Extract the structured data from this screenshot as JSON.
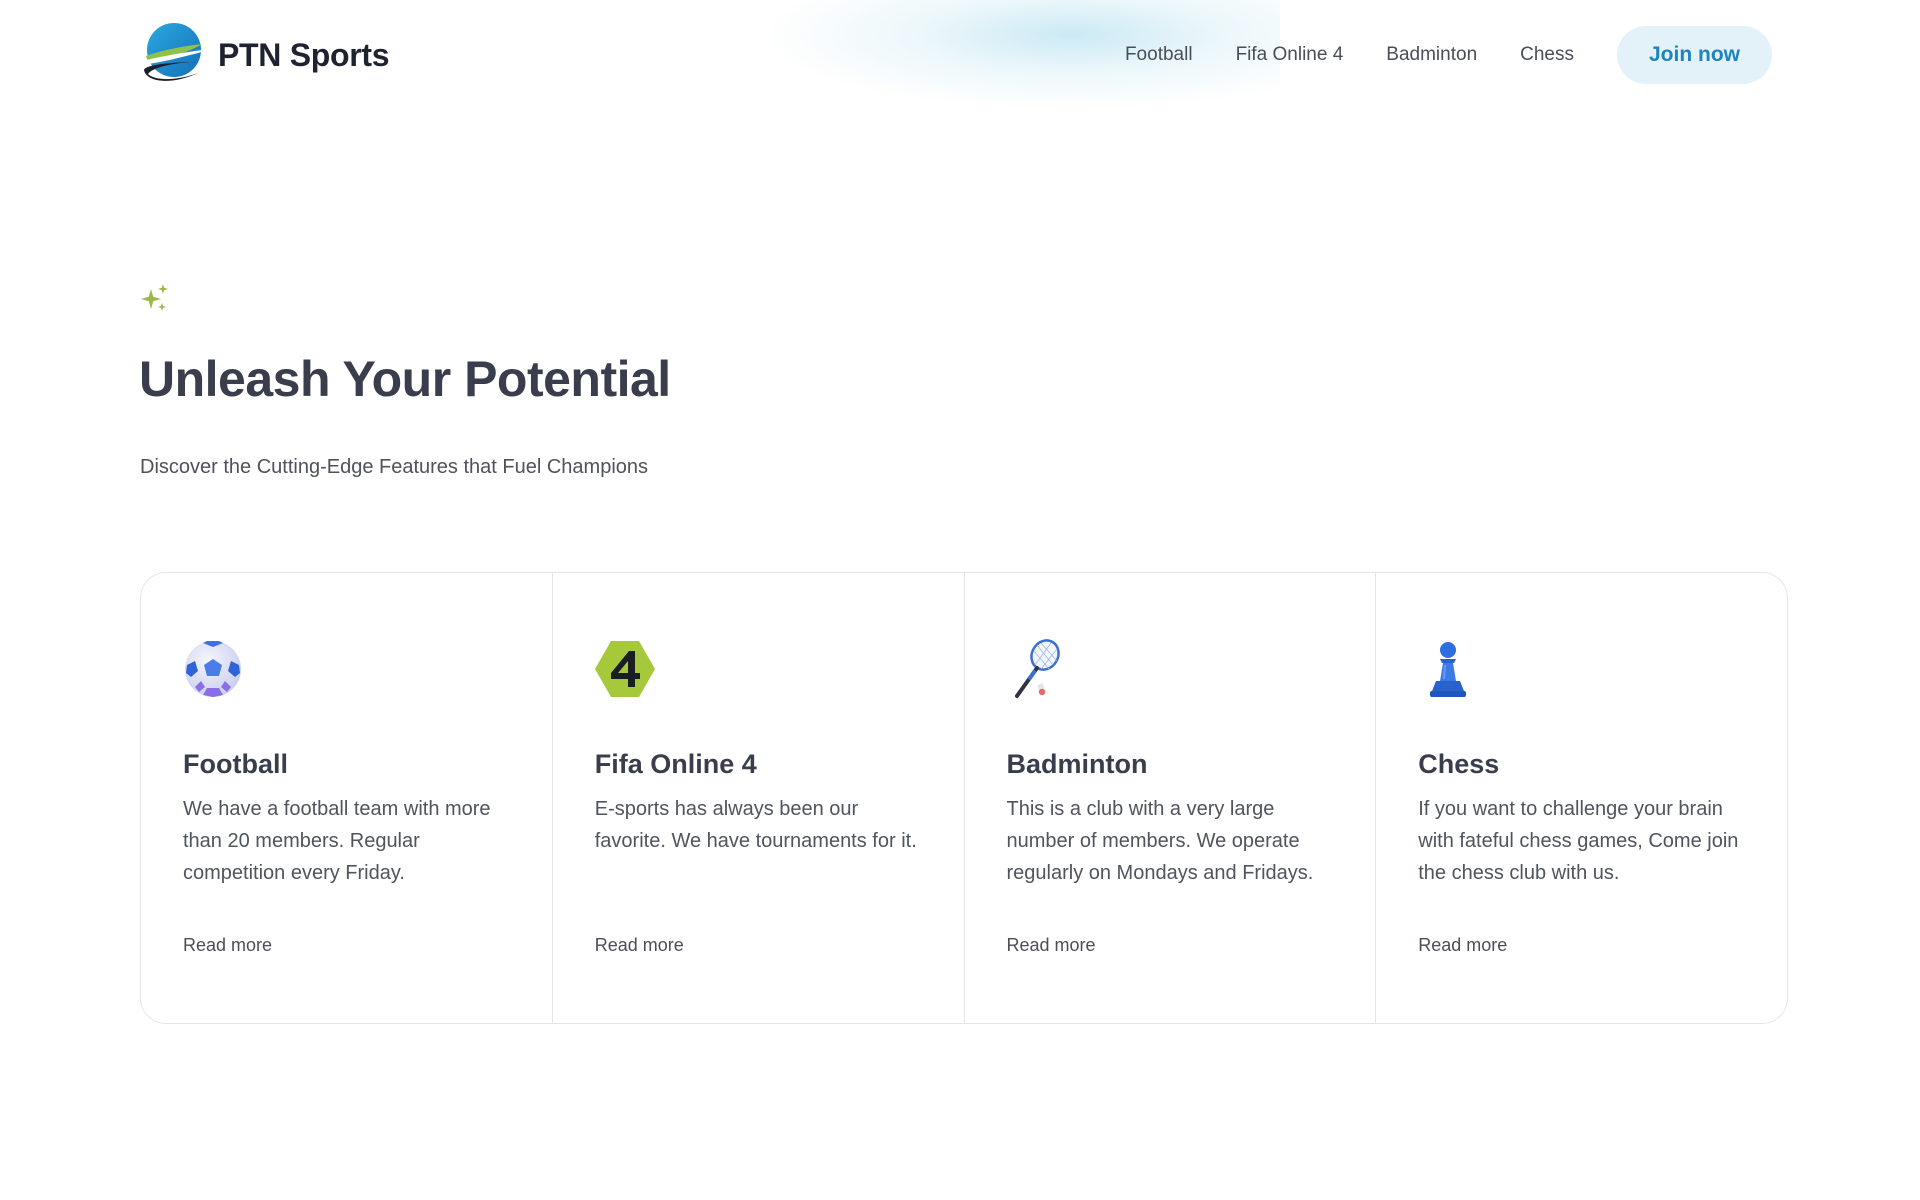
{
  "brand": {
    "name": "PTN Sports"
  },
  "nav": {
    "links": [
      "Football",
      "Fifa Online 4",
      "Badminton",
      "Chess"
    ],
    "join_label": "Join now"
  },
  "hero": {
    "title": "Unleash Your Potential",
    "subtitle": "Discover the Cutting-Edge Features that Fuel Champions",
    "icon": "sparkle-icon"
  },
  "cards": [
    {
      "icon": "soccer-ball-icon",
      "title": "Football",
      "description": "We have a football team with more than 20 members. Regular competition every Friday.",
      "link": "Read more"
    },
    {
      "icon": "fifa-online-4-icon",
      "title": "Fifa Online 4",
      "description": "E-sports has always been our favorite. We have tournaments for it.",
      "link": "Read more"
    },
    {
      "icon": "badminton-racket-icon",
      "title": "Badminton",
      "description": "This is a club with a very large number of members. We operate regularly on Mondays and Fridays.",
      "link": "Read more"
    },
    {
      "icon": "chess-pawn-icon",
      "title": "Chess",
      "description": "If you want to challenge your brain with fateful chess games, Come join the chess club with us.",
      "link": "Read more"
    }
  ],
  "colors": {
    "accent": "#1d84bd",
    "button_bg": "#e3f1f9",
    "heading": "#3a3e4c",
    "sparkle": "#9db84a",
    "fifa_badge": "#a5c93a"
  }
}
